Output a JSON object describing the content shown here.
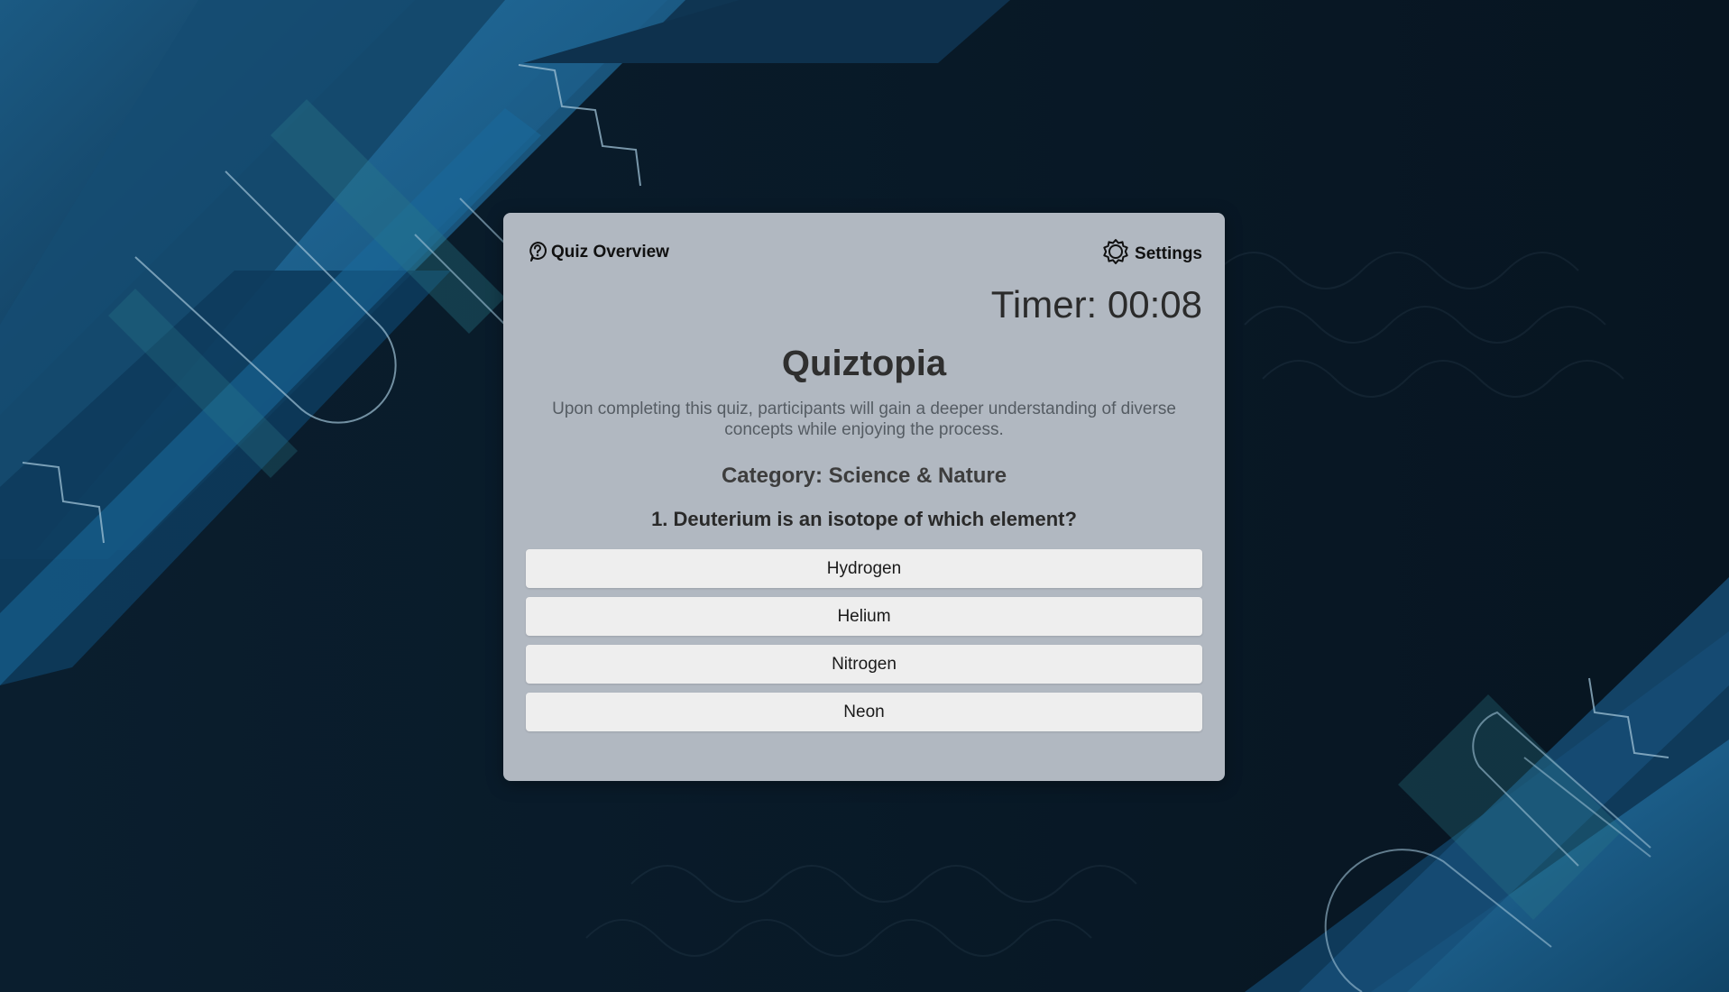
{
  "header": {
    "overview_label": "Quiz Overview",
    "overview_icon": "question-circle-icon",
    "settings_label": "Settings",
    "settings_icon": "gear-icon"
  },
  "timer": {
    "text": "Timer: 00:08"
  },
  "quiz": {
    "title": "Quiztopia",
    "description": "Upon completing this quiz, participants will gain a deeper understanding of diverse concepts while enjoying the process.",
    "category": "Category: Science & Nature",
    "question": "1. Deuterium is an isotope of which element?",
    "answers": [
      {
        "label": "Hydrogen"
      },
      {
        "label": "Helium"
      },
      {
        "label": "Nitrogen"
      },
      {
        "label": "Neon"
      }
    ]
  },
  "colors": {
    "card_background": "#b1b8c1",
    "answer_background": "#eeeeee",
    "page_background": "#0b1a26",
    "accent_blue": "#1f5f8a"
  }
}
